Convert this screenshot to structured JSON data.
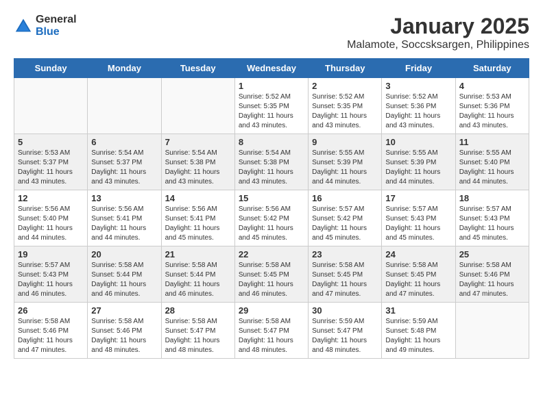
{
  "header": {
    "logo_general": "General",
    "logo_blue": "Blue",
    "title": "January 2025",
    "subtitle": "Malamote, Soccsksargen, Philippines"
  },
  "days_of_week": [
    "Sunday",
    "Monday",
    "Tuesday",
    "Wednesday",
    "Thursday",
    "Friday",
    "Saturday"
  ],
  "weeks": [
    [
      {
        "day": "",
        "info": ""
      },
      {
        "day": "",
        "info": ""
      },
      {
        "day": "",
        "info": ""
      },
      {
        "day": "1",
        "info": "Sunrise: 5:52 AM\nSunset: 5:35 PM\nDaylight: 11 hours and 43 minutes."
      },
      {
        "day": "2",
        "info": "Sunrise: 5:52 AM\nSunset: 5:35 PM\nDaylight: 11 hours and 43 minutes."
      },
      {
        "day": "3",
        "info": "Sunrise: 5:52 AM\nSunset: 5:36 PM\nDaylight: 11 hours and 43 minutes."
      },
      {
        "day": "4",
        "info": "Sunrise: 5:53 AM\nSunset: 5:36 PM\nDaylight: 11 hours and 43 minutes."
      }
    ],
    [
      {
        "day": "5",
        "info": "Sunrise: 5:53 AM\nSunset: 5:37 PM\nDaylight: 11 hours and 43 minutes."
      },
      {
        "day": "6",
        "info": "Sunrise: 5:54 AM\nSunset: 5:37 PM\nDaylight: 11 hours and 43 minutes."
      },
      {
        "day": "7",
        "info": "Sunrise: 5:54 AM\nSunset: 5:38 PM\nDaylight: 11 hours and 43 minutes."
      },
      {
        "day": "8",
        "info": "Sunrise: 5:54 AM\nSunset: 5:38 PM\nDaylight: 11 hours and 43 minutes."
      },
      {
        "day": "9",
        "info": "Sunrise: 5:55 AM\nSunset: 5:39 PM\nDaylight: 11 hours and 44 minutes."
      },
      {
        "day": "10",
        "info": "Sunrise: 5:55 AM\nSunset: 5:39 PM\nDaylight: 11 hours and 44 minutes."
      },
      {
        "day": "11",
        "info": "Sunrise: 5:55 AM\nSunset: 5:40 PM\nDaylight: 11 hours and 44 minutes."
      }
    ],
    [
      {
        "day": "12",
        "info": "Sunrise: 5:56 AM\nSunset: 5:40 PM\nDaylight: 11 hours and 44 minutes."
      },
      {
        "day": "13",
        "info": "Sunrise: 5:56 AM\nSunset: 5:41 PM\nDaylight: 11 hours and 44 minutes."
      },
      {
        "day": "14",
        "info": "Sunrise: 5:56 AM\nSunset: 5:41 PM\nDaylight: 11 hours and 45 minutes."
      },
      {
        "day": "15",
        "info": "Sunrise: 5:56 AM\nSunset: 5:42 PM\nDaylight: 11 hours and 45 minutes."
      },
      {
        "day": "16",
        "info": "Sunrise: 5:57 AM\nSunset: 5:42 PM\nDaylight: 11 hours and 45 minutes."
      },
      {
        "day": "17",
        "info": "Sunrise: 5:57 AM\nSunset: 5:43 PM\nDaylight: 11 hours and 45 minutes."
      },
      {
        "day": "18",
        "info": "Sunrise: 5:57 AM\nSunset: 5:43 PM\nDaylight: 11 hours and 45 minutes."
      }
    ],
    [
      {
        "day": "19",
        "info": "Sunrise: 5:57 AM\nSunset: 5:43 PM\nDaylight: 11 hours and 46 minutes."
      },
      {
        "day": "20",
        "info": "Sunrise: 5:58 AM\nSunset: 5:44 PM\nDaylight: 11 hours and 46 minutes."
      },
      {
        "day": "21",
        "info": "Sunrise: 5:58 AM\nSunset: 5:44 PM\nDaylight: 11 hours and 46 minutes."
      },
      {
        "day": "22",
        "info": "Sunrise: 5:58 AM\nSunset: 5:45 PM\nDaylight: 11 hours and 46 minutes."
      },
      {
        "day": "23",
        "info": "Sunrise: 5:58 AM\nSunset: 5:45 PM\nDaylight: 11 hours and 47 minutes."
      },
      {
        "day": "24",
        "info": "Sunrise: 5:58 AM\nSunset: 5:45 PM\nDaylight: 11 hours and 47 minutes."
      },
      {
        "day": "25",
        "info": "Sunrise: 5:58 AM\nSunset: 5:46 PM\nDaylight: 11 hours and 47 minutes."
      }
    ],
    [
      {
        "day": "26",
        "info": "Sunrise: 5:58 AM\nSunset: 5:46 PM\nDaylight: 11 hours and 47 minutes."
      },
      {
        "day": "27",
        "info": "Sunrise: 5:58 AM\nSunset: 5:46 PM\nDaylight: 11 hours and 48 minutes."
      },
      {
        "day": "28",
        "info": "Sunrise: 5:58 AM\nSunset: 5:47 PM\nDaylight: 11 hours and 48 minutes."
      },
      {
        "day": "29",
        "info": "Sunrise: 5:58 AM\nSunset: 5:47 PM\nDaylight: 11 hours and 48 minutes."
      },
      {
        "day": "30",
        "info": "Sunrise: 5:59 AM\nSunset: 5:47 PM\nDaylight: 11 hours and 48 minutes."
      },
      {
        "day": "31",
        "info": "Sunrise: 5:59 AM\nSunset: 5:48 PM\nDaylight: 11 hours and 49 minutes."
      },
      {
        "day": "",
        "info": ""
      }
    ]
  ]
}
